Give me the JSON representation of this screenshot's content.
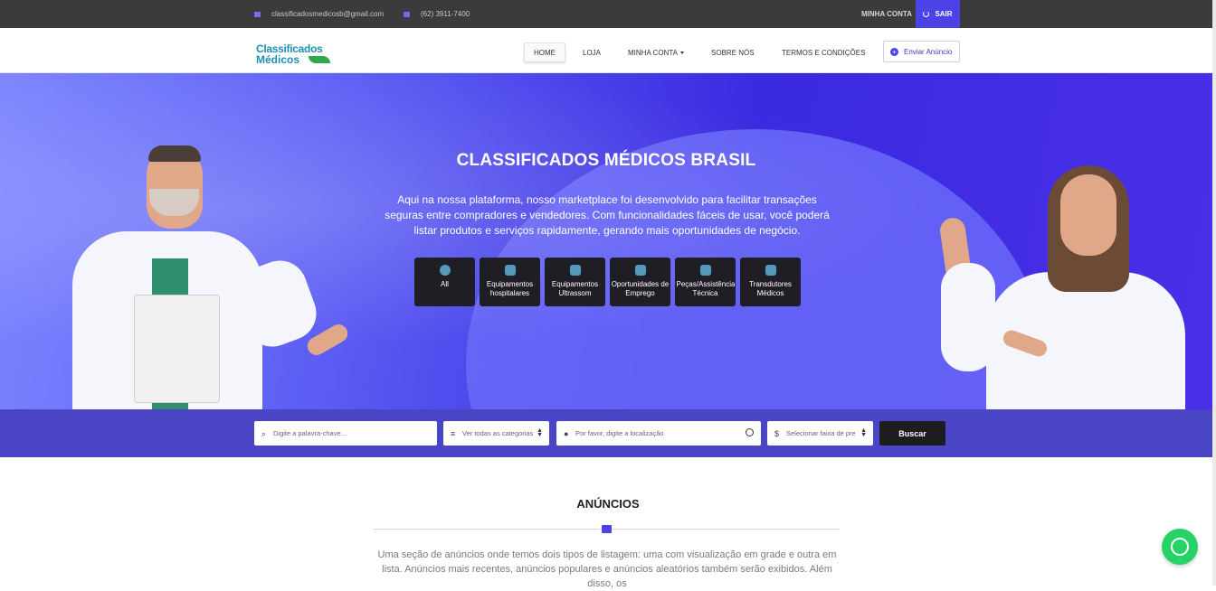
{
  "topbar": {
    "email": "classificadosmedicosb@gmail.com",
    "phone": "(62) 3911-7400",
    "account": "MINHA CONTA",
    "logout": "SAIR"
  },
  "nav": {
    "logo_line1": "Classificados",
    "logo_line2": "Médicos",
    "items": [
      "HOME",
      "LOJA",
      "MINHA CONTA",
      "SOBRE NÓS",
      "TERMOS E CONDIÇÕES"
    ],
    "send_button": "Enviar Anúncio"
  },
  "hero": {
    "title": "CLASSIFICADOS MÉDICOS BRASIL",
    "text": "Aqui na nossa plataforma, nosso marketplace foi desenvolvido para facilitar transações seguras entre compradores e vendedores. Com funcionalidades fáceis de usar, você poderá listar produtos e serviços rapidamente, gerando mais oportunidades de negócio.",
    "categories": [
      {
        "label": "All",
        "icon": "all-icon"
      },
      {
        "label": "Equipamentos hospitalares",
        "icon": "equipment-icon"
      },
      {
        "label": "Equipamentos Ultrassom",
        "icon": "ultrasound-icon"
      },
      {
        "label": "Oportunidades de Emprego",
        "icon": "job-icon"
      },
      {
        "label": "Peças/Assistência Técnica",
        "icon": "service-icon"
      },
      {
        "label": "Transdutores Médicos",
        "icon": "transducer-icon"
      }
    ]
  },
  "search": {
    "keyword_placeholder": "Digite a palavra-chave...",
    "category_value": "Ver todas as categorias",
    "location_placeholder": "Por favor, digite a localização",
    "price_value": "Selecionar faixa de preço",
    "button": "Buscar"
  },
  "ads": {
    "title": "ANÚNCIOS",
    "text": "Uma seção de anúncios onde temos dois tipos de listagem: uma com visualização em grade e outra em lista. Anúncios mais recentes, anúncios populares e anúncios aleatórios também serão exibidos. Além disso, os"
  },
  "colors": {
    "accent": "#4b43e8",
    "topbar": "#3b3b3b",
    "whatsapp": "#25d366"
  }
}
